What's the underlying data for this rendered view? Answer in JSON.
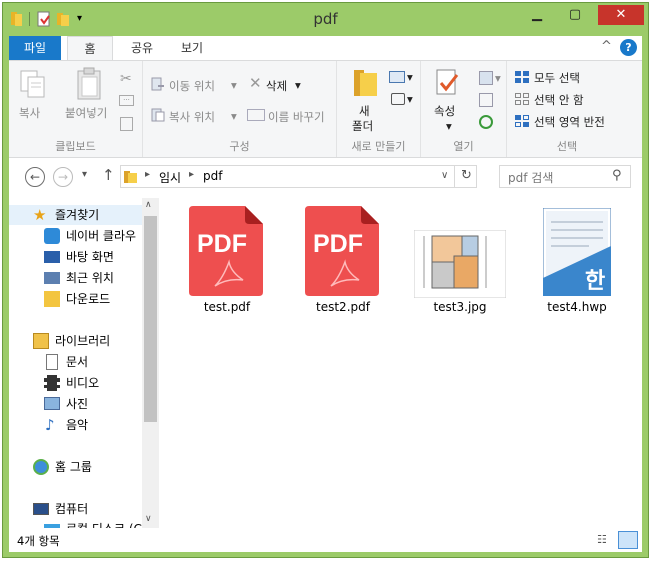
{
  "window": {
    "title": "pdf"
  },
  "tabs": [
    {
      "label": "파일"
    },
    {
      "label": "홈"
    },
    {
      "label": "공유"
    },
    {
      "label": "보기"
    }
  ],
  "ribbon": {
    "clipboard": {
      "copy": "복사",
      "paste": "붙여넣기",
      "label": "클립보드"
    },
    "organize": {
      "move": "이동 위치",
      "delete": "삭제",
      "copyto": "복사 위치",
      "rename": "이름 바꾸기",
      "label": "구성"
    },
    "new": {
      "newfolder_line1": "새",
      "newfolder_line2": "폴더",
      "label": "새로 만들기"
    },
    "open": {
      "properties": "속성",
      "label": "열기"
    },
    "select": {
      "selectall": "모두 선택",
      "selectnone": "선택 안 함",
      "invert": "선택 영역 반전",
      "label": "선택"
    }
  },
  "address": {
    "crumb1": "임시",
    "crumb2": "pdf",
    "search_placeholder": "pdf 검색"
  },
  "sidebar": {
    "items": [
      {
        "label": "즐겨찾기",
        "icon": "star-icon"
      },
      {
        "label": "네이버 클라우",
        "icon": "cloud-icon"
      },
      {
        "label": "바탕 화면",
        "icon": "desktop-icon"
      },
      {
        "label": "최근 위치",
        "icon": "recent-icon"
      },
      {
        "label": "다운로드",
        "icon": "download-icon"
      },
      {
        "label": "라이브러리",
        "icon": "library-icon"
      },
      {
        "label": "문서",
        "icon": "document-icon"
      },
      {
        "label": "비디오",
        "icon": "video-icon"
      },
      {
        "label": "사진",
        "icon": "picture-icon"
      },
      {
        "label": "음악",
        "icon": "music-icon"
      },
      {
        "label": "홈 그룹",
        "icon": "homegroup-icon"
      },
      {
        "label": "컴퓨터",
        "icon": "computer-icon"
      },
      {
        "label": "로컬 디스크 (C",
        "icon": "disk-icon"
      }
    ]
  },
  "files": [
    {
      "name": "test.pdf",
      "type": "pdf",
      "badge": "PDF"
    },
    {
      "name": "test2.pdf",
      "type": "pdf",
      "badge": "PDF"
    },
    {
      "name": "test3.jpg",
      "type": "jpg",
      "badge": ""
    },
    {
      "name": "test4.hwp",
      "type": "hwp",
      "badge": "한"
    }
  ],
  "status": {
    "count": "4개 항목"
  },
  "colors": {
    "accent": "#1979ca",
    "frame": "#9ccb69",
    "pdf": "#ee3e3e",
    "close": "#c7342b"
  }
}
